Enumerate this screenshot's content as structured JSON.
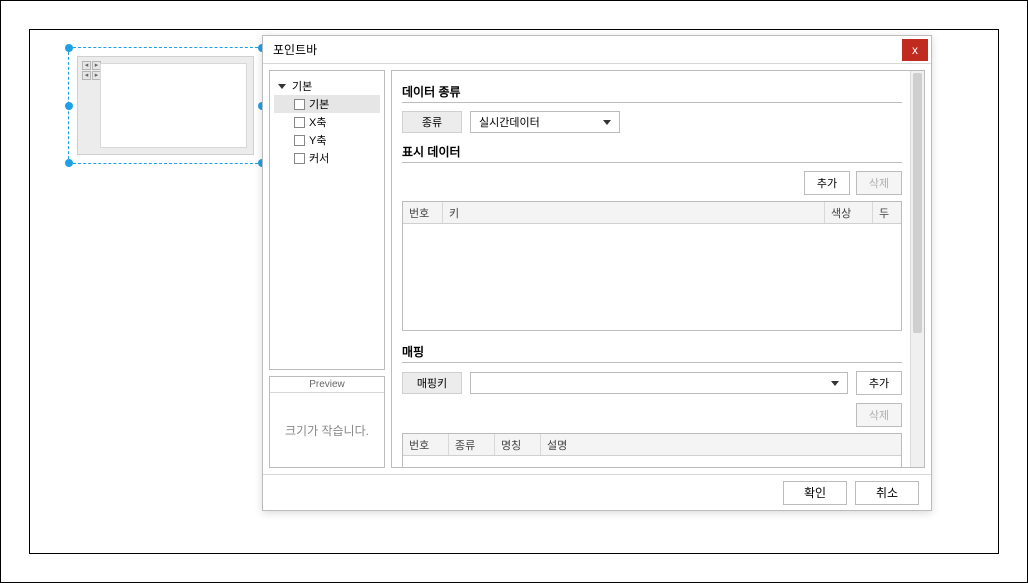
{
  "dialog": {
    "title": "포인트바",
    "close": "x"
  },
  "tree": {
    "root": "기본",
    "items": [
      "기본",
      "X축",
      "Y축",
      "커서"
    ]
  },
  "preview": {
    "header": "Preview",
    "message": "크기가 작습니다."
  },
  "sections": {
    "dataType": {
      "title": "데이터 종류",
      "label": "종류",
      "selected": "실시간데이터"
    },
    "displayData": {
      "title": "표시 데이터",
      "add": "추가",
      "delete": "삭제",
      "columns": [
        "번호",
        "키",
        "색상",
        "두"
      ]
    },
    "mapping": {
      "title": "매핑",
      "keyLabel": "매핑키",
      "add": "추가",
      "delete": "삭제",
      "columns": [
        "번호",
        "종류",
        "명칭",
        "설명"
      ]
    }
  },
  "footer": {
    "ok": "확인",
    "cancel": "취소"
  }
}
